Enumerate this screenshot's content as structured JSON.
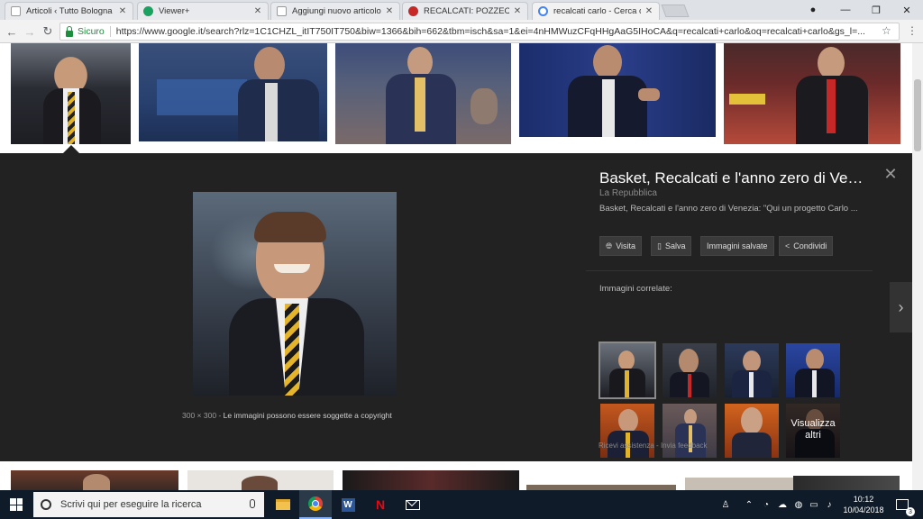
{
  "browser": {
    "tabs": [
      {
        "title": "Articoli ‹ Tutto Bologna Web",
        "favicon_color": "#9e9e9e"
      },
      {
        "title": "Viewer+",
        "favicon_color": "#1aa260"
      },
      {
        "title": "Aggiungi nuovo articolo",
        "favicon_color": "#9e9e9e"
      },
      {
        "title": "RECALCATI: POZZECCO SOTTO",
        "favicon_color": "#c62828"
      },
      {
        "title": "recalcati carlo - Cerca con Google",
        "favicon_color": "#4285f4"
      }
    ],
    "secure_label": "Sicuro",
    "url": "https://www.google.it/search?rlz=1C1CHZL_itIT750IT750&biw=1366&bih=662&tbm=isch&sa=1&ei=4nHMWuzCFqHHgAaG5IHoCA&q=recalcati+carlo&oq=recalcati+carlo&gs_l=..."
  },
  "panel": {
    "title": "Basket, Recalcati e l'anno zero di Venezia",
    "source": "La Repubblica",
    "description": "Basket, Recalcati e l'anno zero di Venezia: \"Qui un progetto Carlo ...",
    "buttons": {
      "visit": "Visita",
      "save": "Salva",
      "saved": "Immagini salvate",
      "share": "Condividi"
    },
    "dimensions": "300 × 300",
    "dim_separator": "-",
    "copyright": "Le immagini possono essere soggette a copyright",
    "related_label": "Immagini correlate:",
    "more_label": "Visualizza altri",
    "help": "Ricevi assistenza",
    "feedback": "Invia feedback",
    "foot_sep": "-"
  },
  "taskbar": {
    "search_placeholder": "Scrivi qui per eseguire la ricerca",
    "time": "10:12",
    "date": "10/04/2018",
    "notifications": "3"
  },
  "colors": {
    "panel_bg": "#222222",
    "taskbar_bg": "#0f1b28",
    "secure_green": "#1e8e3e"
  }
}
